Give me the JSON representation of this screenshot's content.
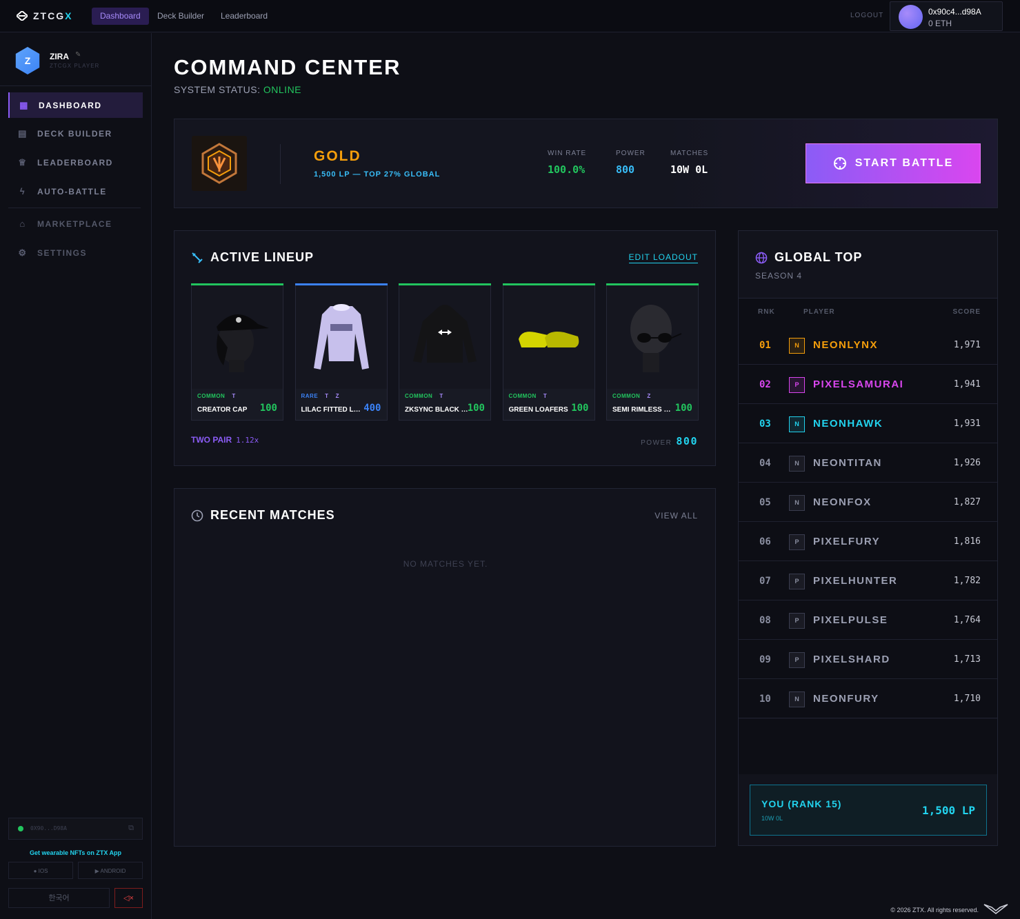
{
  "topbar": {
    "logo_main": "ZTCG",
    "logo_accent": "X",
    "tabs": [
      "Dashboard",
      "Deck Builder",
      "Leaderboard"
    ],
    "logout": "LOGOUT",
    "wallet_address": "0x90c4...d98A",
    "wallet_balance": "0 ETH"
  },
  "sidebar": {
    "avatar_initial": "Z",
    "player_name": "ZIRA",
    "player_role": "ZTCGX PLAYER",
    "items": [
      {
        "label": "DASHBOARD",
        "icon": "grid-icon"
      },
      {
        "label": "DECK BUILDER",
        "icon": "cards-icon"
      },
      {
        "label": "LEADERBOARD",
        "icon": "trophy-icon"
      },
      {
        "label": "AUTO-BATTLE",
        "icon": "bolt-icon"
      },
      {
        "label": "MARKETPLACE",
        "icon": "store-icon"
      },
      {
        "label": "SETTINGS",
        "icon": "gear-icon"
      }
    ],
    "wallet_short": "0X90...D98A",
    "get_app": "Get wearable NFTs on ZTX App",
    "ios": "IOS",
    "android": "ANDROID",
    "language": "한국어"
  },
  "page": {
    "title": "COMMAND CENTER",
    "status_label": "SYSTEM STATUS:",
    "status_value": "ONLINE"
  },
  "hero": {
    "rank": "GOLD",
    "rank_sub": "1,500 LP — TOP 27% GLOBAL",
    "win_rate_label": "WIN RATE",
    "win_rate": "100.0%",
    "power_label": "POWER",
    "power": "800",
    "matches_label": "MATCHES",
    "matches": "10W 0L",
    "battle_button": "START BATTLE"
  },
  "lineup": {
    "title": "ACTIVE LINEUP",
    "edit": "EDIT LOADOUT",
    "cards": [
      {
        "rarity": "COMMON",
        "tags": [
          "T"
        ],
        "name": "CREATOR CAP",
        "power": "100",
        "color": "#22c55e",
        "icon": "cap-icon"
      },
      {
        "rarity": "RARE",
        "tags": [
          "T",
          "Z"
        ],
        "name": "LILAC FITTED LONG SLEEVE",
        "power": "400",
        "color": "#3b82f6",
        "icon": "longsleeve-icon"
      },
      {
        "rarity": "COMMON",
        "tags": [
          "T"
        ],
        "name": "ZKSYNC BLACK HOODIE",
        "power": "100",
        "color": "#22c55e",
        "icon": "hoodie-icon"
      },
      {
        "rarity": "COMMON",
        "tags": [
          "T"
        ],
        "name": "GREEN LOAFERS",
        "power": "100",
        "color": "#22c55e",
        "icon": "loafers-icon"
      },
      {
        "rarity": "COMMON",
        "tags": [
          "Z"
        ],
        "name": "SEMI RIMLESS GLASSES",
        "power": "100",
        "color": "#22c55e",
        "icon": "glasses-icon"
      }
    ],
    "combo": "TWO PAIR",
    "combo_mult": "1.12x",
    "power_label": "POWER",
    "power": "800"
  },
  "recent": {
    "title": "RECENT MATCHES",
    "view_all": "VIEW ALL",
    "empty": "NO MATCHES YET."
  },
  "global": {
    "title": "GLOBAL TOP",
    "season": "SEASON 4",
    "headers": [
      "RNK",
      "PLAYER",
      "SCORE"
    ],
    "rows": [
      {
        "rank": "01",
        "initial": "N",
        "name": "NEONLYNX",
        "score": "1,971",
        "color": "#f59e0b"
      },
      {
        "rank": "02",
        "initial": "P",
        "name": "PIXELSAMURAI",
        "score": "1,941",
        "color": "#d946ef"
      },
      {
        "rank": "03",
        "initial": "N",
        "name": "NEONHAWK",
        "score": "1,931",
        "color": "#22d3ee"
      },
      {
        "rank": "04",
        "initial": "N",
        "name": "NEONTITAN",
        "score": "1,926",
        "color": ""
      },
      {
        "rank": "05",
        "initial": "N",
        "name": "NEONFOX",
        "score": "1,827",
        "color": ""
      },
      {
        "rank": "06",
        "initial": "P",
        "name": "PIXELFURY",
        "score": "1,816",
        "color": ""
      },
      {
        "rank": "07",
        "initial": "P",
        "name": "PIXELHUNTER",
        "score": "1,782",
        "color": ""
      },
      {
        "rank": "08",
        "initial": "P",
        "name": "PIXELPULSE",
        "score": "1,764",
        "color": ""
      },
      {
        "rank": "09",
        "initial": "P",
        "name": "PIXELSHARD",
        "score": "1,713",
        "color": ""
      },
      {
        "rank": "10",
        "initial": "N",
        "name": "NEONFURY",
        "score": "1,710",
        "color": ""
      }
    ],
    "you_label": "YOU (RANK 15)",
    "you_record": "10W 0L",
    "you_lp": "1,500 LP"
  },
  "footer": "© 2026 ZTX. All rights reserved."
}
